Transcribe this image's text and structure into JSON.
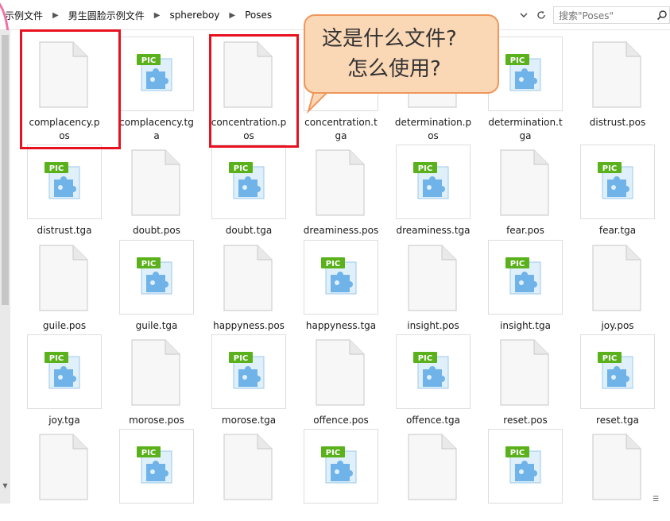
{
  "breadcrumb": {
    "items": [
      "示例文件",
      "男生圆脸示例文件",
      "sphereboy",
      "Poses"
    ]
  },
  "search": {
    "placeholder": "搜索\"Poses\""
  },
  "callout": {
    "line1": "这是什么文件?",
    "line2": "怎么使用?"
  },
  "files": [
    {
      "name": "complacency.pos",
      "line1": "complacency.p",
      "line2": "os",
      "type": "pos"
    },
    {
      "name": "complacency.tga",
      "line1": "complacency.tg",
      "line2": "a",
      "type": "tga"
    },
    {
      "name": "concentration.pos",
      "line1": "concentration.p",
      "line2": "os",
      "type": "pos"
    },
    {
      "name": "concentration.tga",
      "line1": "concentration.t",
      "line2": "ga",
      "type": "tga"
    },
    {
      "name": "determination.pos",
      "line1": "determination.p",
      "line2": "os",
      "type": "pos"
    },
    {
      "name": "determination.tga",
      "line1": "determination.t",
      "line2": "ga",
      "type": "tga"
    },
    {
      "name": "distrust.pos",
      "line1": "distrust.pos",
      "line2": "",
      "type": "pos"
    },
    {
      "name": "distrust.tga",
      "line1": "distrust.tga",
      "line2": "",
      "type": "tga"
    },
    {
      "name": "doubt.pos",
      "line1": "doubt.pos",
      "line2": "",
      "type": "pos"
    },
    {
      "name": "doubt.tga",
      "line1": "doubt.tga",
      "line2": "",
      "type": "tga"
    },
    {
      "name": "dreaminess.pos",
      "line1": "dreaminess.pos",
      "line2": "",
      "type": "pos"
    },
    {
      "name": "dreaminess.tga",
      "line1": "dreaminess.tga",
      "line2": "",
      "type": "tga"
    },
    {
      "name": "fear.pos",
      "line1": "fear.pos",
      "line2": "",
      "type": "pos"
    },
    {
      "name": "fear.tga",
      "line1": "fear.tga",
      "line2": "",
      "type": "tga"
    },
    {
      "name": "guile.pos",
      "line1": "guile.pos",
      "line2": "",
      "type": "pos"
    },
    {
      "name": "guile.tga",
      "line1": "guile.tga",
      "line2": "",
      "type": "tga"
    },
    {
      "name": "happyness.pos",
      "line1": "happyness.pos",
      "line2": "",
      "type": "pos"
    },
    {
      "name": "happyness.tga",
      "line1": "happyness.tga",
      "line2": "",
      "type": "tga"
    },
    {
      "name": "insight.pos",
      "line1": "insight.pos",
      "line2": "",
      "type": "pos"
    },
    {
      "name": "insight.tga",
      "line1": "insight.tga",
      "line2": "",
      "type": "tga"
    },
    {
      "name": "joy.pos",
      "line1": "joy.pos",
      "line2": "",
      "type": "pos"
    },
    {
      "name": "joy.tga",
      "line1": "joy.tga",
      "line2": "",
      "type": "tga"
    },
    {
      "name": "morose.pos",
      "line1": "morose.pos",
      "line2": "",
      "type": "pos"
    },
    {
      "name": "morose.tga",
      "line1": "morose.tga",
      "line2": "",
      "type": "tga"
    },
    {
      "name": "offence.pos",
      "line1": "offence.pos",
      "line2": "",
      "type": "pos"
    },
    {
      "name": "offence.tga",
      "line1": "offence.tga",
      "line2": "",
      "type": "tga"
    },
    {
      "name": "reset.pos",
      "line1": "reset.pos",
      "line2": "",
      "type": "pos"
    },
    {
      "name": "reset.tga",
      "line1": "reset.tga",
      "line2": "",
      "type": "tga"
    },
    {
      "name": "",
      "line1": "",
      "line2": "",
      "type": "pos"
    },
    {
      "name": "",
      "line1": "",
      "line2": "",
      "type": "tga"
    },
    {
      "name": "",
      "line1": "",
      "line2": "",
      "type": "pos"
    },
    {
      "name": "",
      "line1": "",
      "line2": "",
      "type": "tga"
    },
    {
      "name": "",
      "line1": "",
      "line2": "",
      "type": "pos"
    },
    {
      "name": "",
      "line1": "",
      "line2": "",
      "type": "tga"
    },
    {
      "name": "",
      "line1": "",
      "line2": "",
      "type": "pos"
    }
  ],
  "icons": {
    "pos": "blank-document-icon",
    "tga": "pic-image-icon"
  },
  "colors": {
    "highlight": "#e8111f",
    "callout_fill": "#fad7b5",
    "callout_border": "#f0965a",
    "pic_badge": "#5ab11c",
    "pic_puzzle": "#6fb3e8"
  }
}
